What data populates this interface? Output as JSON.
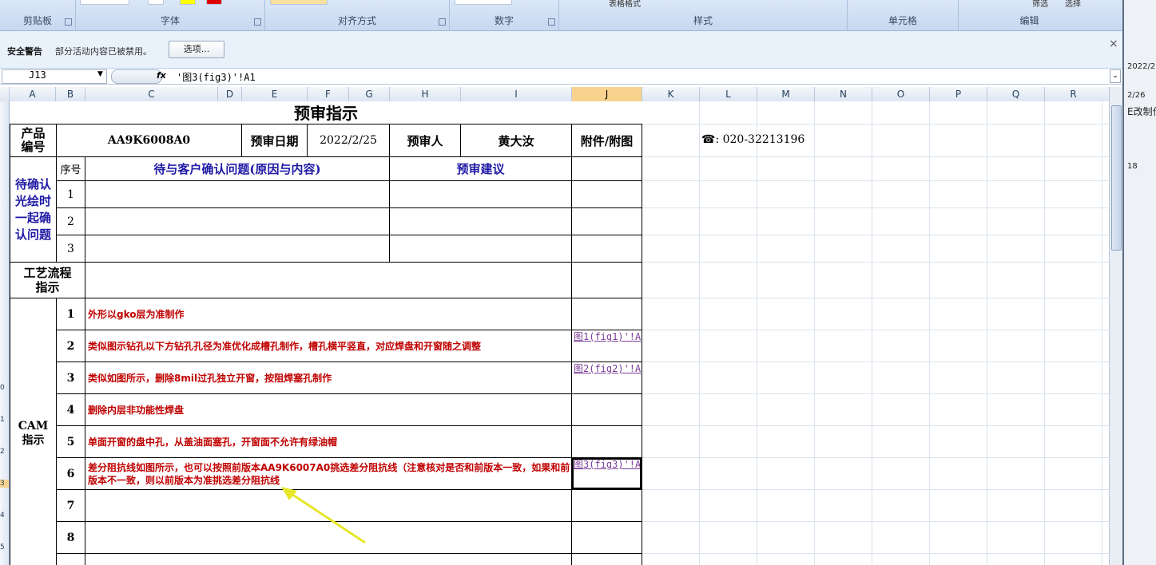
{
  "ribbon": {
    "groups": [
      {
        "label": "剪贴板"
      },
      {
        "label": "字体"
      },
      {
        "label": "对齐方式"
      },
      {
        "label": "数字"
      },
      {
        "label": "样式"
      },
      {
        "label": "单元格"
      },
      {
        "label": "编辑"
      }
    ],
    "styles_partial": "表格格式",
    "edit_partial_1": "筛选",
    "edit_partial_2": "选择"
  },
  "security_bar": {
    "title": "安全警告",
    "message": "部分活动内容已被禁用。",
    "options_button": "选项...",
    "close": "×"
  },
  "formula_bar": {
    "name_box": "J13",
    "fx": "fx",
    "formula": "'图3(fig3)'!A1"
  },
  "columns": [
    "A",
    "B",
    "C",
    "D",
    "E",
    "F",
    "G",
    "H",
    "I",
    "J",
    "K",
    "L",
    "M",
    "N",
    "O",
    "P",
    "Q",
    "R"
  ],
  "selected_column": "J",
  "row_numbers": [
    "0",
    "1",
    "2",
    "3",
    "4",
    "5"
  ],
  "sheet": {
    "title": "预审指示",
    "product_label": "产品编号",
    "product_code": "AA9K6008A0",
    "date_label": "预审日期",
    "date_value": "2022/2/25",
    "reviewer_label": "预审人",
    "reviewer_name": "黄大汝",
    "attachment_label": "附件/附图",
    "phone": "☎: 020-32213196",
    "pending_label": "待确认光绘时一起确认问题",
    "seq_header": "序号",
    "issue_header": "待与客户确认问题(原因与内容)",
    "suggest_header": "预审建议",
    "pending_rows": [
      "1",
      "2",
      "3"
    ],
    "process_label": "工艺流程指示",
    "cam_label": "CAM指示",
    "cam_rows": [
      {
        "no": "1",
        "text": "外形以gko层为准制作",
        "link": ""
      },
      {
        "no": "2",
        "text": "类似图示钻孔以下方钻孔孔径为准优化成槽孔制作，槽孔横平竖直，对应焊盘和开窗随之调整",
        "link": "图1(fig1)'!A"
      },
      {
        "no": "3",
        "text": "类似如图所示，删除8mil过孔独立开窗，按阻焊塞孔制作",
        "link": "图2(fig2)'!A"
      },
      {
        "no": "4",
        "text": "删除内层非功能性焊盘",
        "link": ""
      },
      {
        "no": "5",
        "text": "单面开窗的盘中孔，从盖油面塞孔，开窗面不允许有绿油帽",
        "link": ""
      },
      {
        "no": "6",
        "text": "差分阻抗线如图所示，也可以按照前版本AA9K6007A0挑选差分阻抗线（注意核对是否和前版本一致，如果和前版本不一致，则以前版本为准挑选差分阻抗线",
        "link": "图3(fig3)'!A"
      },
      {
        "no": "7",
        "text": "",
        "link": ""
      },
      {
        "no": "8",
        "text": "",
        "link": ""
      }
    ]
  },
  "background_window": [
    "2022/2",
    "2/26",
    "E改制作",
    "18"
  ],
  "colors": {
    "accent_blue": "#1f1aa6",
    "accent_red": "#c00000",
    "arrow": "#e6e62a"
  }
}
